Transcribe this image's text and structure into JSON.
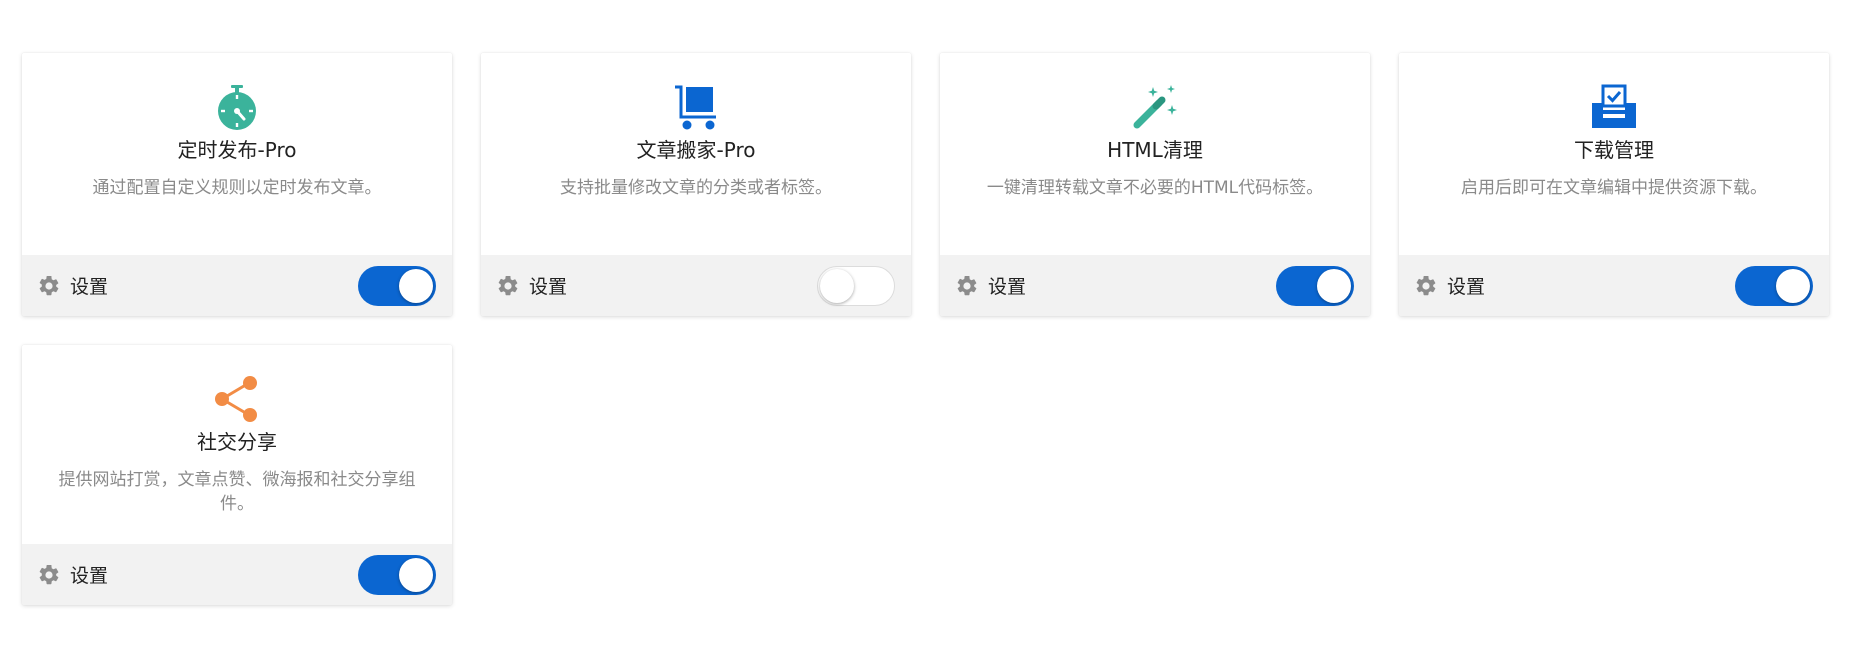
{
  "colors": {
    "accent": "#0b66d1",
    "teal": "#3bb39b",
    "orange": "#f28c45",
    "gear": "#8c8c8c"
  },
  "cards": [
    {
      "title": "定时发布-Pro",
      "description": "通过配置自定义规则以定时发布文章。",
      "icon": "stopwatch-icon",
      "settings_label": "设置",
      "enabled": true
    },
    {
      "title": "文章搬家-Pro",
      "description": "支持批量修改文章的分类或者标签。",
      "icon": "cart-icon",
      "settings_label": "设置",
      "enabled": false
    },
    {
      "title": "HTML清理",
      "description": "一键清理转载文章不必要的HTML代码标签。",
      "icon": "magic-wand-icon",
      "settings_label": "设置",
      "enabled": true
    },
    {
      "title": "下载管理",
      "description": "启用后即可在文章编辑中提供资源下载。",
      "icon": "download-inbox-icon",
      "settings_label": "设置",
      "enabled": true
    },
    {
      "title": "社交分享",
      "description": "提供网站打赏，文章点赞、微海报和社交分享组件。",
      "icon": "share-icon",
      "settings_label": "设置",
      "enabled": true
    }
  ]
}
